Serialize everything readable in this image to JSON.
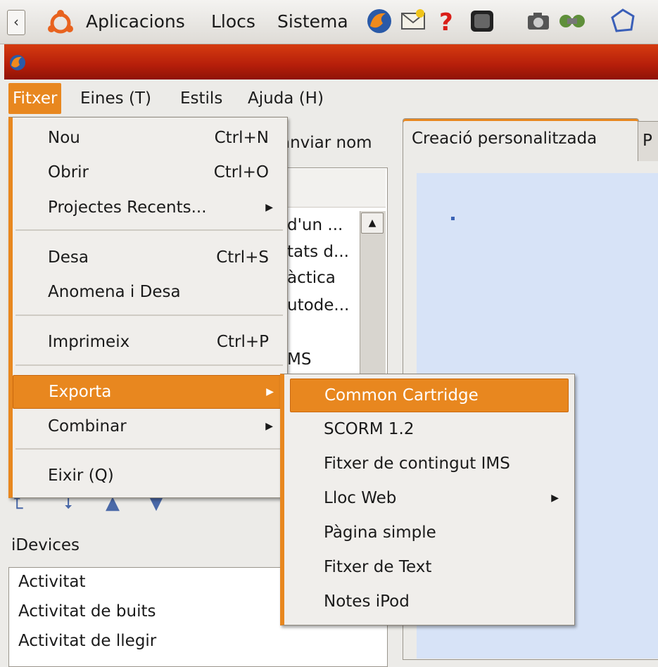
{
  "panel": {
    "menus": [
      "Aplicacions",
      "Llocs",
      "Sistema"
    ],
    "icons": [
      "ubuntu-logo-icon",
      "firefox-icon",
      "mail-icon",
      "help-icon",
      "terminal-icon",
      "camera-icon",
      "network-icon",
      "graph-icon"
    ]
  },
  "menubar": {
    "file": "Fitxer",
    "tools": "Eines (T)",
    "styles": "Estils",
    "help": "Ajuda (H)"
  },
  "left": {
    "rename_partial": "anviar nom",
    "outline_partial": [
      "d'un ...",
      "tats d...",
      "àctica",
      "utode...",
      "MS"
    ],
    "idevices_label": "iDevices",
    "idevices": [
      "Activitat",
      "Activitat de buits",
      "Activitat de llegir"
    ]
  },
  "tabs": {
    "active": "Creació personalitzada",
    "other_partial": "P"
  },
  "file_menu": {
    "new": {
      "label": "Nou",
      "accel": "Ctrl+N"
    },
    "open": {
      "label": "Obrir",
      "accel": "Ctrl+O"
    },
    "recent": {
      "label": "Projectes Recents..."
    },
    "save": {
      "label": "Desa",
      "accel": "Ctrl+S"
    },
    "save_as": {
      "label": "Anomena i Desa"
    },
    "print": {
      "label": "Imprimeix",
      "accel": "Ctrl+P"
    },
    "export": {
      "label": "Exporta"
    },
    "merge": {
      "label": "Combinar"
    },
    "quit": {
      "label": "Eixir (Q)"
    }
  },
  "export_menu": {
    "items": [
      "Common Cartridge",
      "SCORM 1.2",
      "Fitxer de contingut IMS",
      "Lloc Web",
      "Pàgina simple",
      "Fitxer de Text",
      "Notes iPod"
    ],
    "selected": "Common Cartridge"
  },
  "colors": {
    "accent": "#e8871f",
    "titlebar": "#c0260a",
    "canvas": "#d7e3f7"
  }
}
